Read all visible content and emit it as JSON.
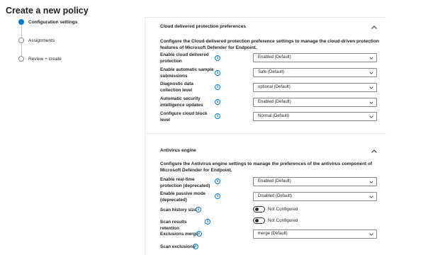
{
  "page": {
    "title": "Create a new policy"
  },
  "wizard": {
    "steps": [
      {
        "label": "Configuration settings",
        "state": "active"
      },
      {
        "label": "Assignments",
        "state": "pending"
      },
      {
        "label": "Review + create",
        "state": "pending"
      }
    ]
  },
  "cloud_section": {
    "title": "Cloud delivered protection preferences",
    "description": "Configure the Cloud-delivered protection preference settings to manage the cloud-driven protection features of Microsoft Defender for Endpoint.",
    "settings": [
      {
        "label": "Enable cloud delivered protection",
        "value": "Enabled (Default)"
      },
      {
        "label": "Enable automatic sample submissions",
        "value": "Safe (Default)"
      },
      {
        "label": "Diagnostic data collection level",
        "value": "optional (Default)"
      },
      {
        "label": "Automatic security intelligence updates",
        "value": "Enabled (Default)"
      },
      {
        "label": "Configure cloud block level",
        "value": "Normal (Default)"
      }
    ]
  },
  "antivirus_section": {
    "title": "Antivirus engine",
    "description": "Configure the Antivirus engine settings to manage the preferences of the antivirus component of Microsoft Defender for Endpoint.",
    "settings": [
      {
        "label": "Enable real-time protection (deprecated)",
        "value": "Enabled (Default)"
      },
      {
        "label": "Enable passive mode (deprecated)",
        "value": "Disabled (Default)"
      },
      {
        "label": "Scan history size",
        "toggle": "Not Configured"
      },
      {
        "label": "Scan results retention",
        "toggle": "Not Configured"
      },
      {
        "label": "Exclusions merge",
        "value": "merge (Default)"
      },
      {
        "label": "Scan exclusions"
      }
    ]
  },
  "colors": {
    "accent": "#0078d4",
    "border": "#8a8886",
    "divider": "#edebe9",
    "text": "#201f1e"
  },
  "icons": {
    "info": "info-circle-icon",
    "collapse": "chevron-up-icon",
    "dropdown": "chevron-down-icon"
  }
}
